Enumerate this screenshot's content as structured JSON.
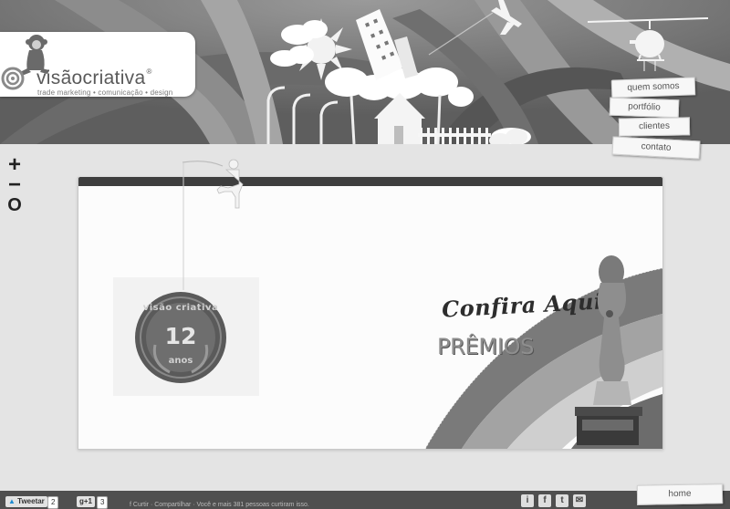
{
  "brand": {
    "name": "visãocriativa",
    "reg": "®",
    "tagline": "trade marketing • comunicação • design"
  },
  "nav": [
    {
      "label": "quem somos"
    },
    {
      "label": "portfólio"
    },
    {
      "label": "clientes"
    },
    {
      "label": "contato"
    }
  ],
  "zoom": {
    "plus": "+",
    "minus": "−",
    "reset": "O"
  },
  "panel": {
    "cta": "Confira Aqui",
    "premios": "PRÊMIOS"
  },
  "medal": {
    "top": "visão criativa",
    "number": "12",
    "bottom": "anos"
  },
  "footer": {
    "tweet_label": "Tweetar",
    "tweet_count": "2",
    "gplus_label": "g+1",
    "gplus_count": "3",
    "links": "f Curtir  ·  Compartilhar  ·  Você e mais 381 pessoas curtiram isso.",
    "icons": [
      "info-icon",
      "facebook-icon",
      "twitter-icon",
      "email-icon"
    ],
    "home": "home"
  }
}
